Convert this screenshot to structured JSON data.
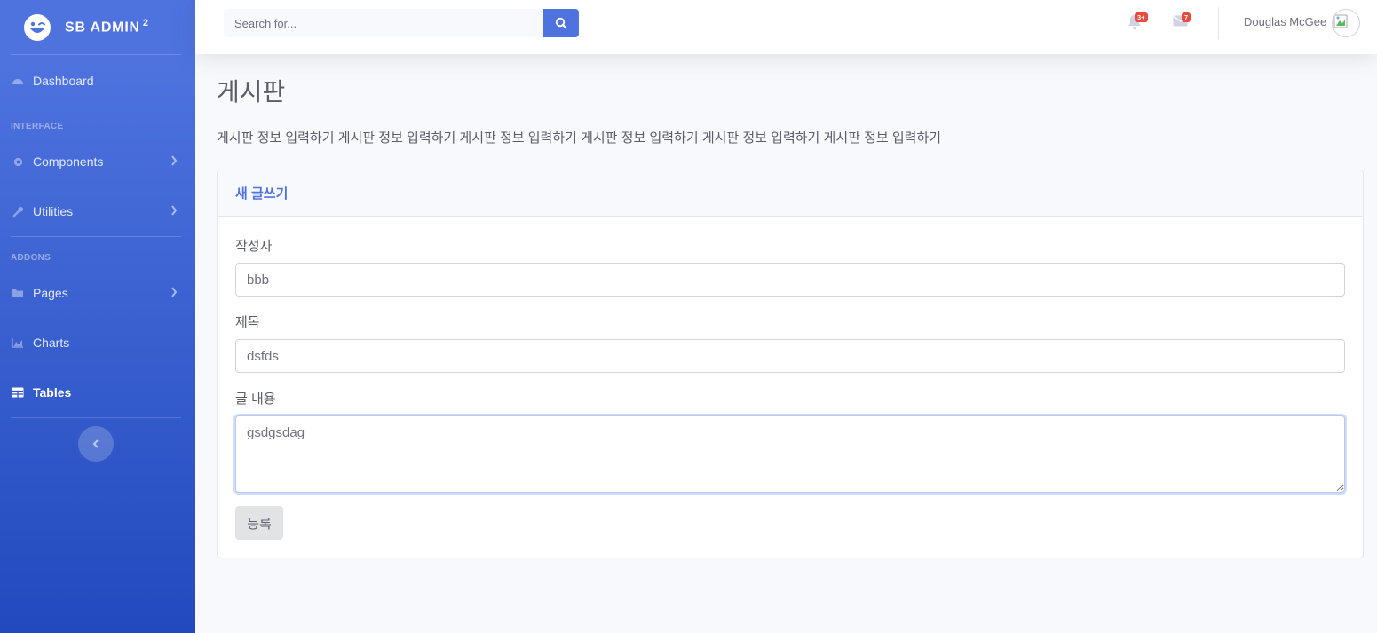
{
  "brand": {
    "name": "SB ADMIN",
    "sup": "2"
  },
  "sidebar": {
    "dashboard": "Dashboard",
    "heading_interface": "INTERFACE",
    "components": "Components",
    "utilities": "Utilities",
    "heading_addons": "ADDONS",
    "pages": "Pages",
    "charts": "Charts",
    "tables": "Tables"
  },
  "topbar": {
    "search_placeholder": "Search for...",
    "alerts_count": "3+",
    "messages_count": "7",
    "user_name": "Douglas McGee"
  },
  "main": {
    "title": "게시판",
    "description": "게시판 정보 입력하기 게시판 정보 입력하기 게시판 정보 입력하기 게시판 정보 입력하기 게시판 정보 입력하기 게시판 정보 입력하기",
    "card_title": "새 글쓰기",
    "writer_label": "작성자",
    "writer_value": "bbb",
    "subject_label": "제목",
    "subject_value": "dsfds",
    "content_label": "글 내용",
    "content_value": "gsdgsdag",
    "submit_label": "등록"
  },
  "colors": {
    "primary": "#4e73df",
    "danger": "#e74a3b",
    "text": "#5a5c69"
  }
}
